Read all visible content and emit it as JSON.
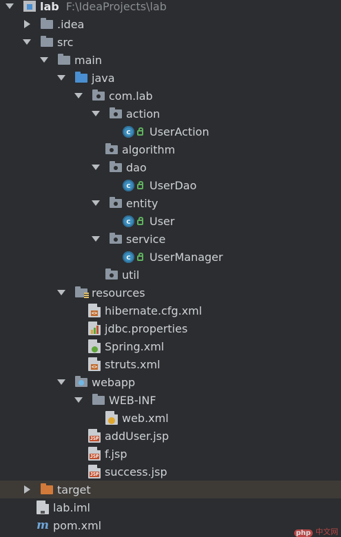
{
  "project": {
    "name": "lab",
    "path": "F:\\IdeaProjects\\lab"
  },
  "tree": [
    {
      "label": "lab",
      "path_text": "F:\\IdeaProjects\\lab",
      "icon": "project-icon",
      "level": 0,
      "arrow": "down",
      "bold": true
    },
    {
      "label": ".idea",
      "icon": "folder-icon",
      "level": 1,
      "arrow": "right"
    },
    {
      "label": "src",
      "icon": "folder-icon",
      "level": 1,
      "arrow": "down"
    },
    {
      "label": "main",
      "icon": "folder-icon",
      "level": 2,
      "arrow": "down"
    },
    {
      "label": "java",
      "icon": "source-folder-icon",
      "level": 3,
      "arrow": "down"
    },
    {
      "label": "com.lab",
      "icon": "package-icon",
      "level": 4,
      "arrow": "down"
    },
    {
      "label": "action",
      "icon": "package-icon",
      "level": 5,
      "arrow": "down"
    },
    {
      "label": "UserAction",
      "icon": "class-icon",
      "level": 6,
      "arrow": "none"
    },
    {
      "label": "algorithm",
      "icon": "package-icon",
      "level": 5,
      "arrow": "none"
    },
    {
      "label": "dao",
      "icon": "package-icon",
      "level": 5,
      "arrow": "down"
    },
    {
      "label": "UserDao",
      "icon": "class-icon",
      "level": 6,
      "arrow": "none"
    },
    {
      "label": "entity",
      "icon": "package-icon",
      "level": 5,
      "arrow": "down"
    },
    {
      "label": "User",
      "icon": "class-icon",
      "level": 6,
      "arrow": "none"
    },
    {
      "label": "service",
      "icon": "package-icon",
      "level": 5,
      "arrow": "down"
    },
    {
      "label": "UserManager",
      "icon": "class-icon",
      "level": 6,
      "arrow": "none"
    },
    {
      "label": "util",
      "icon": "package-icon",
      "level": 5,
      "arrow": "none"
    },
    {
      "label": "resources",
      "icon": "resources-folder-icon",
      "level": 3,
      "arrow": "down"
    },
    {
      "label": "hibernate.cfg.xml",
      "icon": "xml-file-icon",
      "level": 4,
      "arrow": "none"
    },
    {
      "label": "jdbc.properties",
      "icon": "properties-file-icon",
      "level": 4,
      "arrow": "none"
    },
    {
      "label": "Spring.xml",
      "icon": "spring-file-icon",
      "level": 4,
      "arrow": "none"
    },
    {
      "label": "struts.xml",
      "icon": "xml-file-icon",
      "level": 4,
      "arrow": "none"
    },
    {
      "label": "webapp",
      "icon": "web-folder-icon",
      "level": 3,
      "arrow": "down"
    },
    {
      "label": "WEB-INF",
      "icon": "folder-icon",
      "level": 4,
      "arrow": "down"
    },
    {
      "label": "web.xml",
      "icon": "web-xml-file-icon",
      "level": 5,
      "arrow": "none"
    },
    {
      "label": "addUser.jsp",
      "icon": "jsp-file-icon",
      "level": 4,
      "arrow": "none"
    },
    {
      "label": "f.jsp",
      "icon": "jsp-file-icon",
      "level": 4,
      "arrow": "none"
    },
    {
      "label": "success.jsp",
      "icon": "jsp-file-icon",
      "level": 4,
      "arrow": "none"
    },
    {
      "label": "target",
      "icon": "excluded-folder-icon",
      "level": 1,
      "arrow": "right",
      "highlight": true
    },
    {
      "label": "lab.iml",
      "icon": "iml-file-icon",
      "level": 1,
      "arrow": "none"
    },
    {
      "label": "pom.xml",
      "icon": "maven-file-icon",
      "level": 1,
      "arrow": "none"
    }
  ],
  "watermark": {
    "badge": "php",
    "text": "中文网"
  },
  "colors": {
    "background": "#2b2d30",
    "text": "#cfd2d6",
    "highlight": "#3e3a36",
    "folder": "#8c96a2",
    "source_folder": "#4a8fd1",
    "excluded_folder": "#d17a3a",
    "class_icon": "#3c8dbc"
  }
}
